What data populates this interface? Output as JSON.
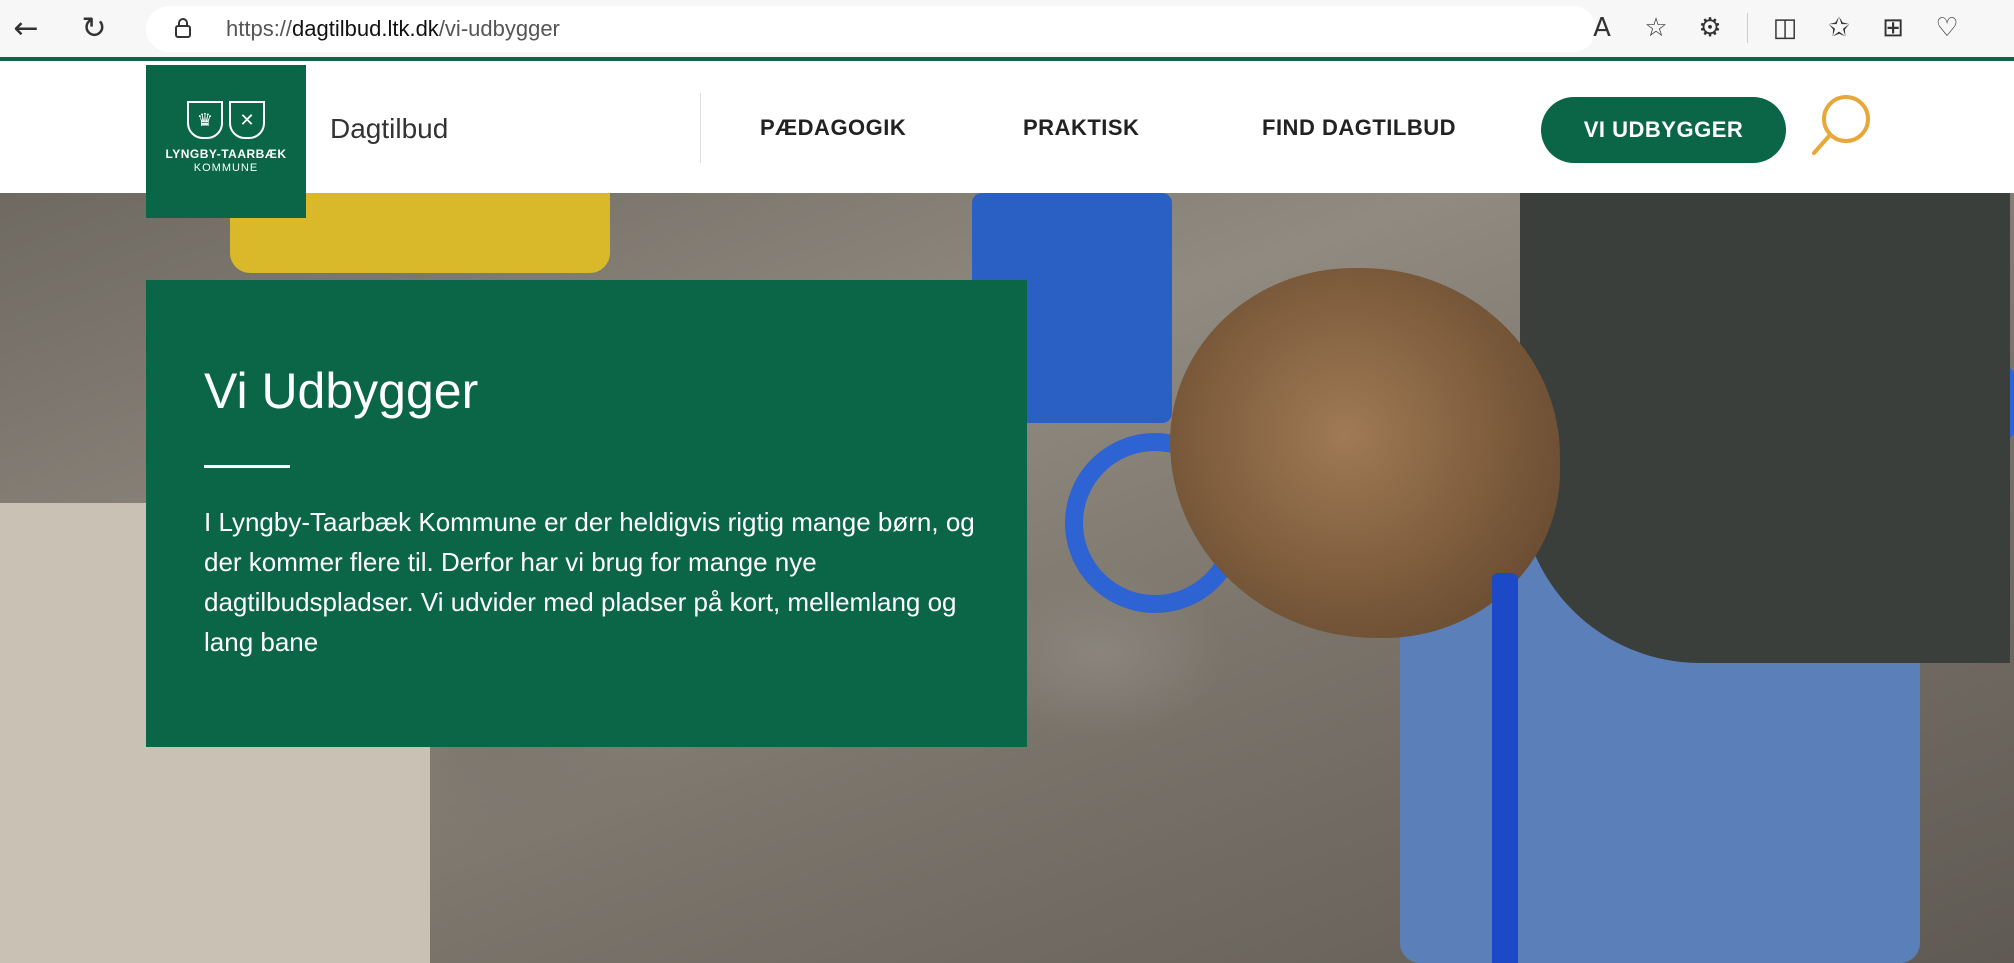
{
  "browser": {
    "url_prefix": "https://",
    "url_host": "dagtilbud.ltk.dk",
    "url_path": "/vi-udbygger"
  },
  "logo": {
    "line1": "LYNGBY-TAARBÆK",
    "line2": "KOMMUNE"
  },
  "header": {
    "site_name": "Dagtilbud",
    "nav": [
      "PÆDAGOGIK",
      "PRAKTISK",
      "FIND DAGTILBUD"
    ],
    "cta": "VI UDBYGGER"
  },
  "hero": {
    "title": "Vi Udbygger",
    "text": "I Lyngby-Taarbæk Kommune er der heldigvis rigtig mange børn, og der kommer flere til. Derfor har vi brug for mange nye dagtilbudspladser. Vi udvider med pladser på kort, mellemlang og lang bane"
  },
  "icons": {
    "back": "back-arrow-icon",
    "refresh": "refresh-icon",
    "lock": "lock-icon",
    "read_aloud": "read-aloud-icon",
    "favorite": "star-icon",
    "extensions": "extensions-icon",
    "split": "split-screen-icon",
    "favorites": "favorites-icon",
    "collections": "collections-icon",
    "health": "browser-essentials-icon",
    "search": "search-icon"
  },
  "colors": {
    "brand_green": "#0b6547"
  }
}
